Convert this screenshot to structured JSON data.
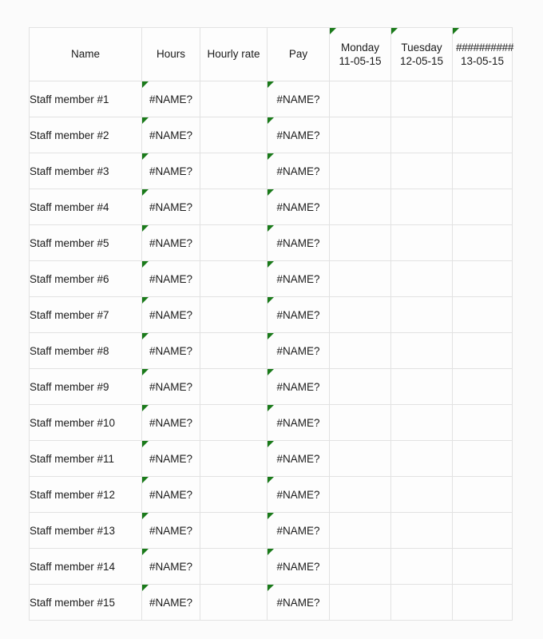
{
  "table": {
    "columns": [
      {
        "key": "name",
        "label": "Name",
        "type": "text"
      },
      {
        "key": "hours",
        "label": "Hours",
        "type": "text"
      },
      {
        "key": "rate",
        "label": "Hourly rate",
        "type": "text"
      },
      {
        "key": "pay",
        "label": "Pay",
        "type": "text"
      },
      {
        "key": "day1",
        "label": "Monday",
        "date": "11-05-15",
        "type": "day"
      },
      {
        "key": "day2",
        "label": "Tuesday",
        "date": "12-05-15",
        "type": "day"
      },
      {
        "key": "day3",
        "label": "##########",
        "date": "13-05-15",
        "type": "day"
      }
    ],
    "header": {
      "name": "Name",
      "hours": "Hours",
      "rate": "Hourly rate",
      "pay": "Pay",
      "day1_name": "Monday",
      "day1_date": "11-05-15",
      "day2_name": "Tuesday",
      "day2_date": "12-05-15",
      "day3_name": "##########",
      "day3_date": "13-05-15"
    },
    "error_value": "#NAME?",
    "rows": [
      {
        "name": "Staff member #1",
        "hours": "#NAME?",
        "rate": "",
        "pay": "#NAME?",
        "day1": "",
        "day2": "",
        "day3": ""
      },
      {
        "name": "Staff member #2",
        "hours": "#NAME?",
        "rate": "",
        "pay": "#NAME?",
        "day1": "",
        "day2": "",
        "day3": ""
      },
      {
        "name": "Staff member #3",
        "hours": "#NAME?",
        "rate": "",
        "pay": "#NAME?",
        "day1": "",
        "day2": "",
        "day3": ""
      },
      {
        "name": "Staff member #4",
        "hours": "#NAME?",
        "rate": "",
        "pay": "#NAME?",
        "day1": "",
        "day2": "",
        "day3": ""
      },
      {
        "name": "Staff member #5",
        "hours": "#NAME?",
        "rate": "",
        "pay": "#NAME?",
        "day1": "",
        "day2": "",
        "day3": ""
      },
      {
        "name": "Staff member #6",
        "hours": "#NAME?",
        "rate": "",
        "pay": "#NAME?",
        "day1": "",
        "day2": "",
        "day3": ""
      },
      {
        "name": "Staff member #7",
        "hours": "#NAME?",
        "rate": "",
        "pay": "#NAME?",
        "day1": "",
        "day2": "",
        "day3": ""
      },
      {
        "name": "Staff member #8",
        "hours": "#NAME?",
        "rate": "",
        "pay": "#NAME?",
        "day1": "",
        "day2": "",
        "day3": ""
      },
      {
        "name": "Staff member #9",
        "hours": "#NAME?",
        "rate": "",
        "pay": "#NAME?",
        "day1": "",
        "day2": "",
        "day3": ""
      },
      {
        "name": "Staff member #10",
        "hours": "#NAME?",
        "rate": "",
        "pay": "#NAME?",
        "day1": "",
        "day2": "",
        "day3": ""
      },
      {
        "name": "Staff member #11",
        "hours": "#NAME?",
        "rate": "",
        "pay": "#NAME?",
        "day1": "",
        "day2": "",
        "day3": ""
      },
      {
        "name": "Staff member #12",
        "hours": "#NAME?",
        "rate": "",
        "pay": "#NAME?",
        "day1": "",
        "day2": "",
        "day3": ""
      },
      {
        "name": "Staff member #13",
        "hours": "#NAME?",
        "rate": "",
        "pay": "#NAME?",
        "day1": "",
        "day2": "",
        "day3": ""
      },
      {
        "name": "Staff member #14",
        "hours": "#NAME?",
        "rate": "",
        "pay": "#NAME?",
        "day1": "",
        "day2": "",
        "day3": ""
      },
      {
        "name": "Staff member #15",
        "hours": "#NAME?",
        "rate": "",
        "pay": "#NAME?",
        "day1": "",
        "day2": "",
        "day3": ""
      }
    ],
    "comment_markers": {
      "header_columns": [
        "day1",
        "day2",
        "day3"
      ],
      "row_columns": [
        "hours",
        "pay"
      ]
    }
  },
  "colors": {
    "page_background": "#fbfbfb",
    "cell_background": "#fdfdfd",
    "grid_line": "#e2e2e2",
    "text": "#1b1b1b",
    "comment_marker": "#1a7a1a"
  }
}
